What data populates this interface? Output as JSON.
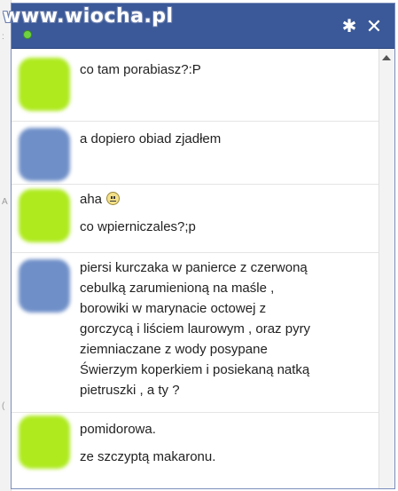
{
  "watermark": "www.wiocha.pl",
  "titlebar": {
    "gear_icon": "gear-icon",
    "close_icon": "close-icon",
    "close_glyph": "✕",
    "gear_glyph": "✱"
  },
  "colors": {
    "titlebar": "#3b5998",
    "friend_avatar": "#aeea1e",
    "me_avatar": "#6f8fc8"
  },
  "messages": [
    {
      "sender": "friend",
      "lines": [
        "co tam porabiasz?:P"
      ]
    },
    {
      "sender": "me",
      "lines": [
        "a dopiero obiad zjadłem"
      ]
    },
    {
      "sender": "friend",
      "lines": [
        "aha",
        "co wpierniczales?;p"
      ]
    },
    {
      "sender": "me",
      "lines": [
        "piersi kurczaka w panierce z czerwoną",
        "cebulką zarumienioną na maśle ,",
        "borowiki w marynacie octowej z",
        "gorczycą i liściem laurowym , oraz pyry",
        "ziemniaczane z wody posypane",
        "Świerzym koperkiem i posiekaną natką",
        "pietruszki , a ty ?"
      ]
    },
    {
      "sender": "friend",
      "lines": [
        "pomidorowa.",
        "ze szczyptą makaronu."
      ]
    }
  ]
}
